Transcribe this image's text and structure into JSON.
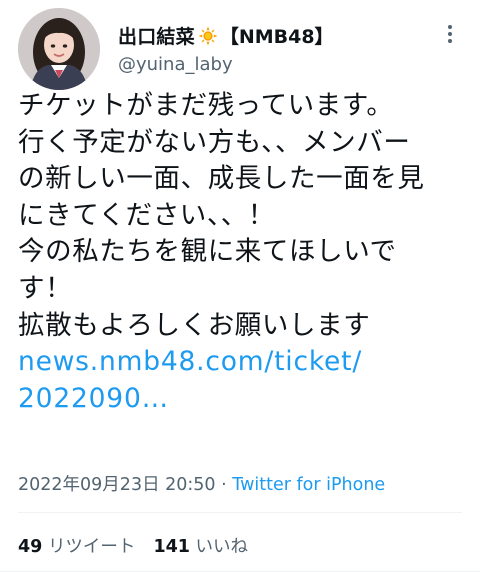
{
  "author": {
    "display_name": "出口結菜",
    "group_tag": "【NMB48】",
    "handle": "@yuina_laby",
    "name_emoji_icon": "orange-sun-emoji"
  },
  "tweet": {
    "lines": [
      "チケットがまだ残っています。",
      "行く予定がない方も、、メンバー",
      "の新しい一面、成長した一面を見",
      "にきてください、、！",
      "今の私たちを観に来てほしいで",
      "す！",
      "拡散もよろしくお願いします"
    ],
    "link_line1": "news.nmb48.com/ticket/",
    "link_line2": "2022090…"
  },
  "meta": {
    "datetime": "2022年09月23日 20:50",
    "separator": " · ",
    "source": "Twitter for iPhone"
  },
  "stats": {
    "retweets_count": "49",
    "retweets_label": "リツイート",
    "likes_count": "141",
    "likes_label": "いいね"
  },
  "colors": {
    "text": "#0f1419",
    "secondary": "#536471",
    "link": "#1d9bf0",
    "divider": "#eff3f4"
  },
  "icons": {
    "more": "more-vertical-icon"
  }
}
